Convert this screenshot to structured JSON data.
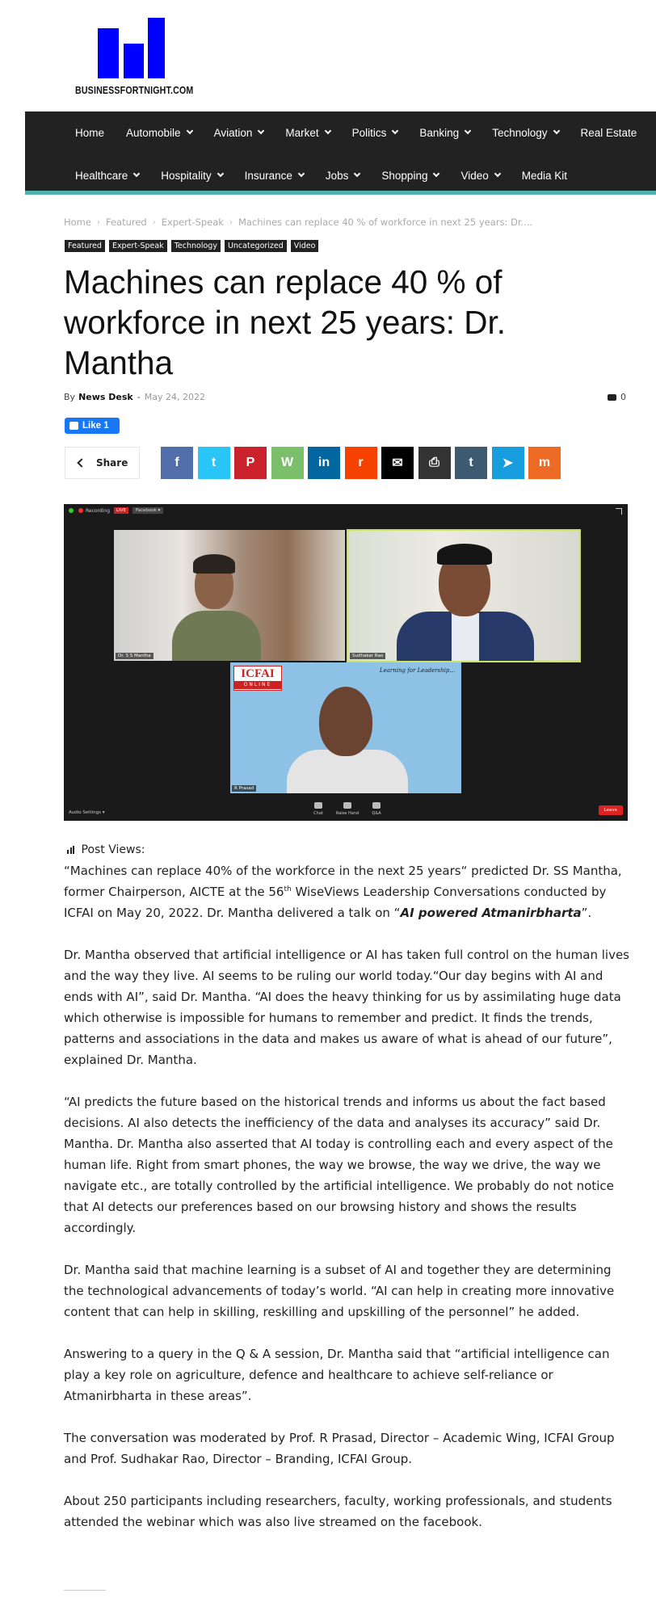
{
  "site": {
    "name": "BUSINESSFORTNIGHT.COM",
    "logo_color": "#0000ff"
  },
  "nav": {
    "row1": [
      {
        "label": "Home",
        "dropdown": false
      },
      {
        "label": "Automobile",
        "dropdown": true
      },
      {
        "label": "Aviation",
        "dropdown": true
      },
      {
        "label": "Market",
        "dropdown": true
      },
      {
        "label": "Politics",
        "dropdown": true
      },
      {
        "label": "Banking",
        "dropdown": true
      },
      {
        "label": "Technology",
        "dropdown": true
      },
      {
        "label": "Real Estate",
        "dropdown": false
      }
    ],
    "row2": [
      {
        "label": "Healthcare",
        "dropdown": true
      },
      {
        "label": "Hospitality",
        "dropdown": true
      },
      {
        "label": "Insurance",
        "dropdown": true
      },
      {
        "label": "Jobs",
        "dropdown": true
      },
      {
        "label": "Shopping",
        "dropdown": true
      },
      {
        "label": "Video",
        "dropdown": true
      },
      {
        "label": "Media Kit",
        "dropdown": false
      }
    ],
    "background": "#222222",
    "accent": "#4db2ab"
  },
  "breadcrumb": [
    "Home",
    "Featured",
    "Expert-Speak",
    "Machines can replace 40 % of workforce in next 25 years: Dr...."
  ],
  "breadcrumb_separator": "›",
  "tags": [
    "Featured",
    "Expert-Speak",
    "Technology",
    "Uncategorized",
    "Video"
  ],
  "article": {
    "title": "Machines can replace 40 % of workforce in next 25 years: Dr. Mantha",
    "by_label": "By",
    "author": "News Desk",
    "dash": "-",
    "date": "May 24, 2022",
    "comments": "0",
    "like_label": "Like 1",
    "share_label": "Share",
    "post_views_label": "Post Views:",
    "p1_part1": " “Machines can replace 40% of the workforce in the next 25 years“ predicted Dr. SS Mantha, former Chairperson, AICTE at the 56",
    "p1_sup": "th",
    "p1_part2": " WiseViews Leadership Conversations conducted by ICFAI on May 20, 2022. Dr. Mantha delivered a talk on “",
    "p1_emph": "AI powered Atmanirbharta",
    "p1_end": "”.",
    "p2": "Dr. Mantha observed that artificial intelligence or AI has taken full control on the human lives and the way they live. AI seems to be ruling our world today.“Our day begins with AI and ends with AI”, said Dr. Mantha. “AI does the heavy thinking for us by assimilating huge data which otherwise is impossible for humans to remember and predict. It finds the trends, patterns and associations in the data and makes us aware of what is ahead of our future”, explained Dr. Mantha.",
    "p3": "“AI predicts the future based on the historical trends and informs us about the fact based decisions.  AI also detects the inefficiency of the data and analyses its accuracy” said Dr. Mantha. Dr. Mantha also asserted that AI today is controlling each and every aspect of the human life. Right from smart phones, the way we browse, the way we drive, the way we navigate etc., are totally controlled by the artificial intelligence. We probably do not notice that AI detects our preferences based on our browsing history and shows the results accordingly.",
    "p4": "Dr. Mantha said that machine learning is a subset of AI and together they are determining the technological advancements of today’s world. “AI can help in creating more innovative content that can help in skilling, reskilling and upskilling of the personnel” he added.",
    "p5": "Answering to a query in the Q & A session, Dr. Mantha said that “artificial intelligence can play a key role on agriculture, defence and healthcare to achieve self-reliance or Atmanirbharta in these areas”.",
    "p6": "The conversation was moderated by Prof. R Prasad, Director – Academic Wing, ICFAI Group and Prof. Sudhakar Rao, Director – Branding, ICFAI Group.",
    "p7": "About 250 participants including researchers, faculty, working professionals, and students attended the webinar which was also live streamed on the facebook."
  },
  "socials": [
    {
      "icon": "facebook-icon",
      "glyph": "f",
      "color": "#516eab"
    },
    {
      "icon": "twitter-icon",
      "glyph": "t",
      "color": "#29c5f6"
    },
    {
      "icon": "pinterest-icon",
      "glyph": "P",
      "color": "#ca212a"
    },
    {
      "icon": "whatsapp-icon",
      "glyph": "W",
      "color": "#7bbf6a"
    },
    {
      "icon": "linkedin-icon",
      "glyph": "in",
      "color": "#0266a0"
    },
    {
      "icon": "reddit-icon",
      "glyph": "r",
      "color": "#f54200"
    },
    {
      "icon": "email-icon",
      "glyph": "✉",
      "color": "#000000"
    },
    {
      "icon": "print-icon",
      "glyph": "⎙",
      "color": "#333333"
    },
    {
      "icon": "tumblr-icon",
      "glyph": "t",
      "color": "#3e5a70"
    },
    {
      "icon": "telegram-icon",
      "glyph": "➤",
      "color": "#179cde"
    },
    {
      "icon": "mix-icon",
      "glyph": "m",
      "color": "#ed6b24"
    }
  ],
  "video": {
    "recording_label": "Recording",
    "live_label": "LIVE",
    "facebook_label": "Facebook ▾",
    "tile1_name": "Dr. S S Mantha",
    "tile2_name": "Sudhakar Rao",
    "tile3_name": "R Prasad",
    "icfai_text": "ICFAI",
    "icfai_sub": "ONLINE",
    "leadership_text": "Learning for Leadership...",
    "audio_settings": "Audio Settings ▾",
    "ctrl_chat": "Chat",
    "ctrl_raise": "Raise Hand",
    "ctrl_qa": "Q&A",
    "leave_label": "Leave"
  }
}
